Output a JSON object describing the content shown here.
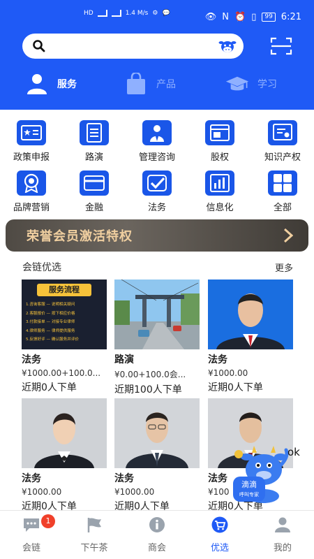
{
  "status": {
    "speed": "1.4 M/s",
    "battery": "99",
    "time": "6:21"
  },
  "tabs": [
    {
      "label": "服务",
      "icon": "person-icon",
      "active": true
    },
    {
      "label": "产品",
      "icon": "bag-icon",
      "active": false
    },
    {
      "label": "学习",
      "icon": "graduation-cap-icon",
      "active": false
    }
  ],
  "categories": [
    {
      "label": "政策申报",
      "icon": "id-card-icon"
    },
    {
      "label": "路演",
      "icon": "document-icon"
    },
    {
      "label": "管理咨询",
      "icon": "manager-icon"
    },
    {
      "label": "股权",
      "icon": "window-icon"
    },
    {
      "label": "知识产权",
      "icon": "certificate-icon"
    },
    {
      "label": "品牌营销",
      "icon": "award-icon"
    },
    {
      "label": "金融",
      "icon": "card-icon"
    },
    {
      "label": "法务",
      "icon": "checkmark-icon"
    },
    {
      "label": "信息化",
      "icon": "bar-chart-icon"
    },
    {
      "label": "全部",
      "icon": "grid-icon"
    }
  ],
  "banner": {
    "text": "荣誉会员激活特权"
  },
  "section": {
    "title": "会链优选",
    "more": "更多"
  },
  "products": [
    {
      "title": "法务",
      "price": "¥1000.00+100.0...",
      "orders": "近期0人下单",
      "thumb": "flow",
      "thumb_title": "服务流程",
      "thumb_lines": [
        "1.咨询客服 — 说明相关疑问",
        "2.客服报价 — 按下相应价格",
        "3.付款接单 — 对接专业律师",
        "4.律师服务 — 律师提供服务",
        "5.反馈好评 — 确认服务并评价"
      ]
    },
    {
      "title": "路演",
      "price": "¥0.00+100.0会...",
      "orders": "近期100人下单",
      "thumb": "street"
    },
    {
      "title": "法务",
      "price": "¥1000.00",
      "orders": "近期0人下单",
      "thumb": "portrait-red"
    },
    {
      "title": "法务",
      "price": "¥1000.00",
      "orders": "近期0人下单",
      "thumb": "portrait-young"
    },
    {
      "title": "法务",
      "price": "¥1000.00",
      "orders": "近期0人下单",
      "thumb": "portrait-glasses"
    },
    {
      "title": "法务",
      "price": "¥100",
      "orders": "近期0人下单",
      "thumb": "portrait-suit"
    }
  ],
  "fab": {
    "label": "滴滴",
    "sub": "呼叫专家",
    "ok": "ok"
  },
  "nav": [
    {
      "label": "会链",
      "icon": "chat-icon",
      "badge": "1"
    },
    {
      "label": "下午茶",
      "icon": "flag-icon"
    },
    {
      "label": "商会",
      "icon": "info-icon"
    },
    {
      "label": "优选",
      "icon": "cart-icon",
      "active": true
    },
    {
      "label": "我的",
      "icon": "user-icon"
    }
  ],
  "colors": {
    "primary": "#1f5af6",
    "banner_text": "#f0cfa0",
    "badge": "#f0402a"
  }
}
